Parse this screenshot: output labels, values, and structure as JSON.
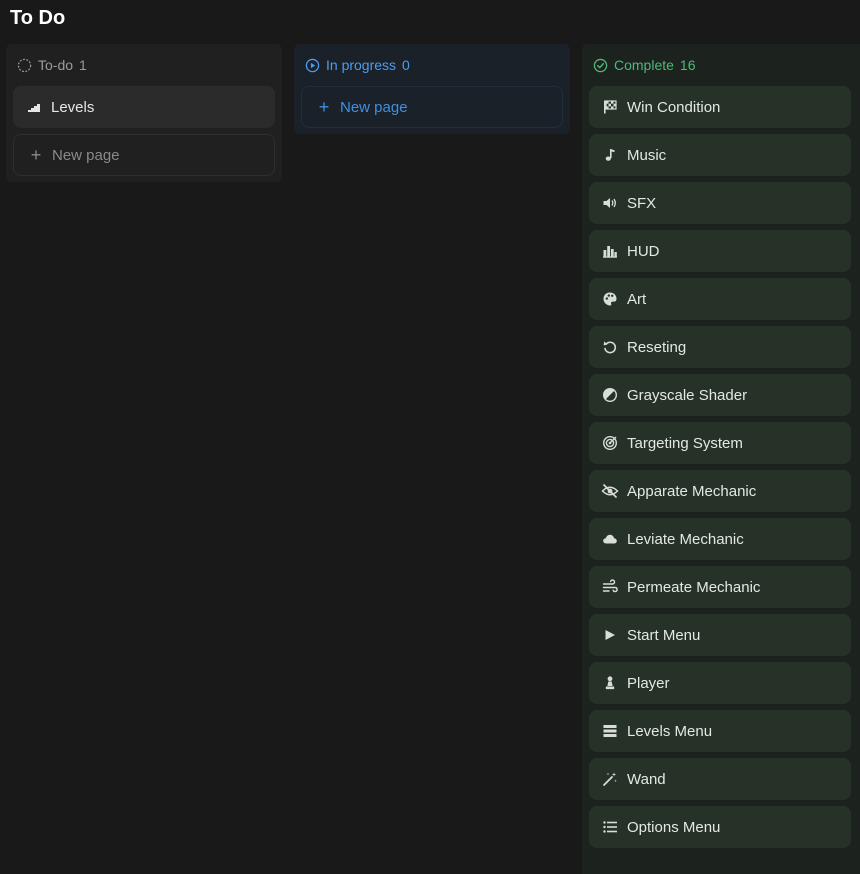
{
  "page": {
    "title": "To Do"
  },
  "columns": {
    "todo": {
      "label": "To-do",
      "count": "1",
      "status_icon": "dashed-circle-icon",
      "color": "#9b9b9b",
      "cards": [
        {
          "title": "Levels",
          "icon": "stairs-icon"
        }
      ],
      "new_page_label": "New page"
    },
    "progress": {
      "label": "In progress",
      "count": "0",
      "status_icon": "play-circle-icon",
      "color": "#4b9cf0",
      "cards": [],
      "new_page_label": "New page"
    },
    "complete": {
      "label": "Complete",
      "count": "16",
      "status_icon": "check-circle-icon",
      "color": "#4fb879",
      "cards": [
        {
          "title": "Win Condition",
          "icon": "checkered-flag-icon"
        },
        {
          "title": "Music",
          "icon": "music-note-icon"
        },
        {
          "title": "SFX",
          "icon": "speaker-icon"
        },
        {
          "title": "HUD",
          "icon": "bar-chart-icon"
        },
        {
          "title": "Art",
          "icon": "palette-icon"
        },
        {
          "title": "Reseting",
          "icon": "reset-arrow-icon"
        },
        {
          "title": "Grayscale Shader",
          "icon": "half-circle-icon"
        },
        {
          "title": "Targeting System",
          "icon": "target-icon"
        },
        {
          "title": "Apparate Mechanic",
          "icon": "eye-slash-icon"
        },
        {
          "title": "Leviate Mechanic",
          "icon": "cloud-icon"
        },
        {
          "title": "Permeate Mechanic",
          "icon": "wind-icon"
        },
        {
          "title": "Start Menu",
          "icon": "play-icon"
        },
        {
          "title": "Player",
          "icon": "chess-pawn-icon"
        },
        {
          "title": "Levels Menu",
          "icon": "stacked-bars-icon"
        },
        {
          "title": "Wand",
          "icon": "magic-wand-icon"
        },
        {
          "title": "Options Menu",
          "icon": "list-icon"
        }
      ]
    }
  }
}
